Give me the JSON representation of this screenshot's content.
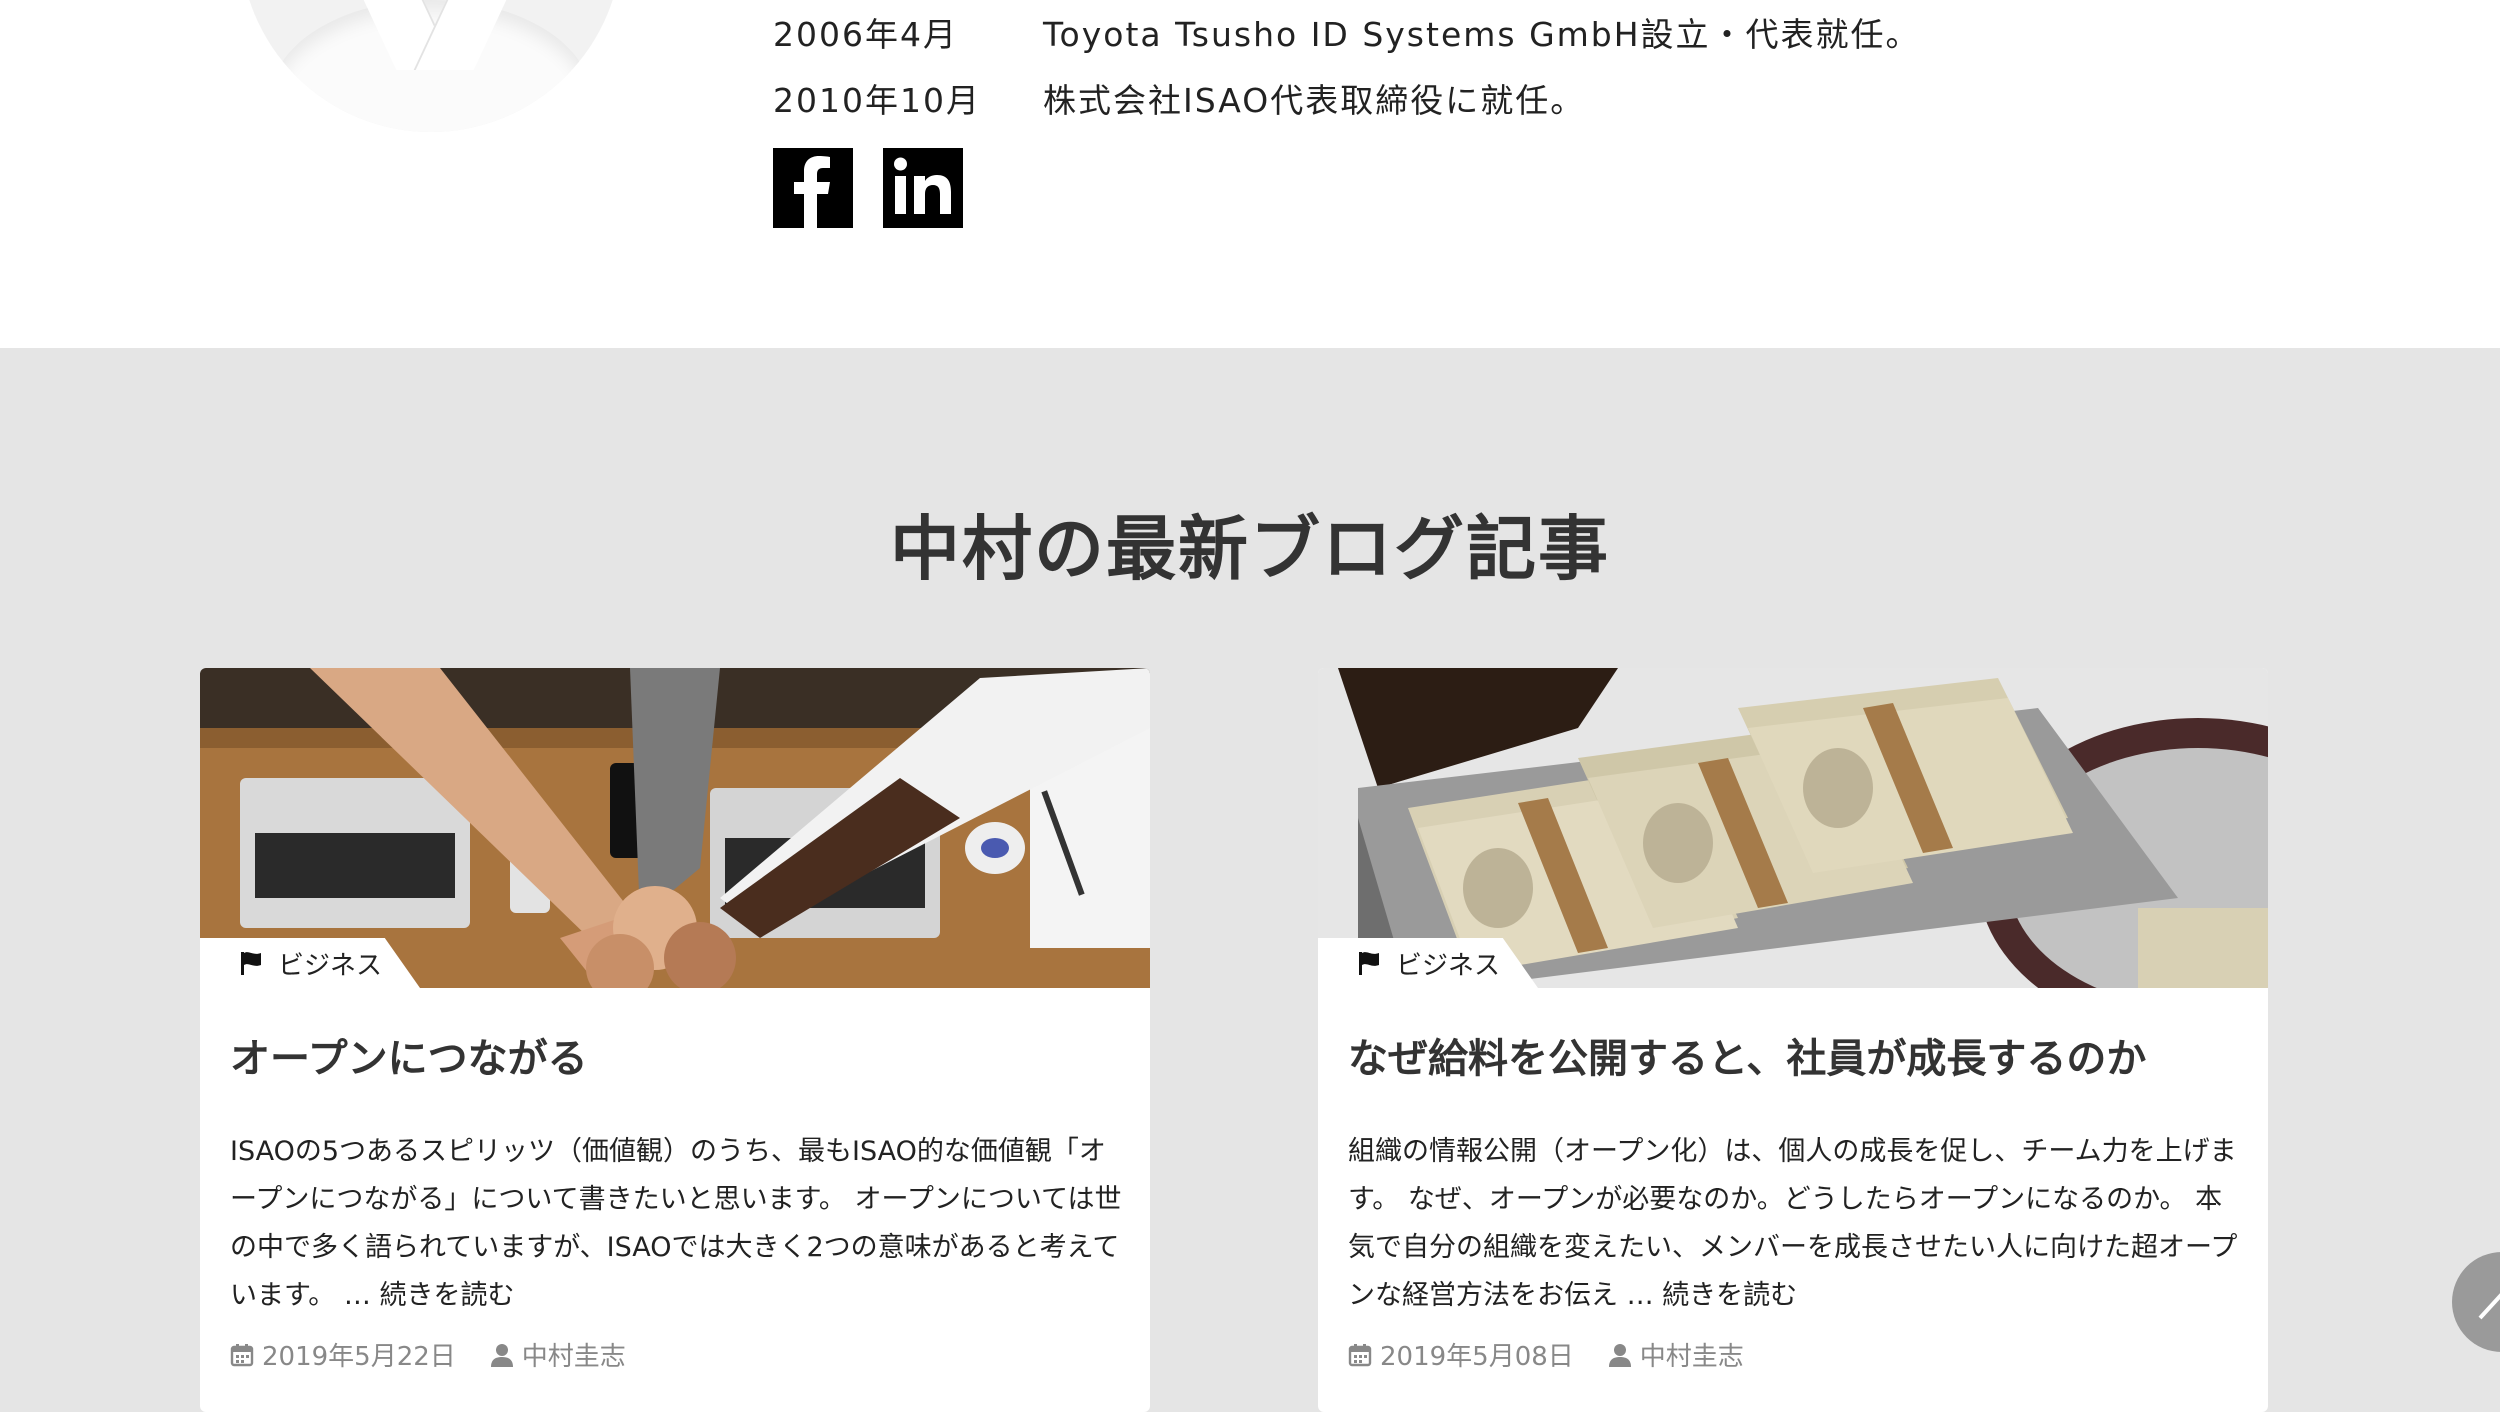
{
  "profile": {
    "history": [
      {
        "date": "2006年4月",
        "event": "Toyota Tsusho ID Systems GmbH設立・代表就任。"
      },
      {
        "date": "2010年10月",
        "event": "株式会社ISAO代表取締役に就任。"
      }
    ],
    "social": [
      {
        "icon": "facebook-icon"
      },
      {
        "icon": "linkedin-icon"
      }
    ]
  },
  "blog": {
    "title": "中村の最新ブログ記事",
    "posts": [
      {
        "category": "ビジネス",
        "title": "オープンにつながる",
        "excerpt": "ISAOの5つあるスピリッツ（価値観）のうち、最もISAO的な価値観「オープンにつながる」について書きたいと思います。 オープンについては世の中で多く語られていますが、ISAOでは大きく2つの意味があると考えています。 … 続きを読む",
        "date": "2019年5月22日",
        "author": "中村圭志"
      },
      {
        "category": "ビジネス",
        "title": "なぜ給料を公開すると、社員が成長するのか",
        "excerpt": "組織の情報公開（オープン化）は、個人の成長を促し、チーム力を上げます。 なぜ、オープンが必要なのか。どうしたらオープンになるのか。 本気で自分の組織を変えたい、メンバーを成長させたい人に向けた超オープンな経営方法をお伝え … 続きを読む",
        "date": "2019年5月08日",
        "author": "中村圭志"
      }
    ]
  },
  "colors": {
    "blog_background": "#e5e5e5",
    "card_background": "#ffffff",
    "meta_text": "#888888"
  }
}
